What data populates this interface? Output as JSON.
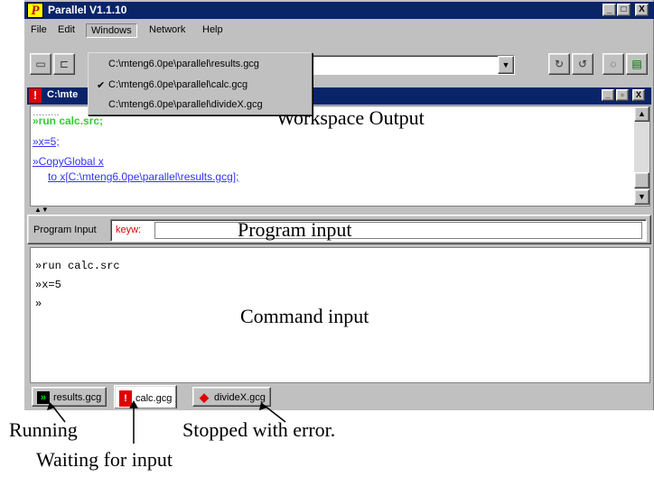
{
  "app": {
    "logo_letter": "P",
    "title": "Parallel V1.1.10",
    "minimize": "_",
    "maximize": "□",
    "close": "X"
  },
  "menubar": {
    "items": [
      "File",
      "Edit",
      "Windows",
      "Network",
      "Help"
    ]
  },
  "windows_menu": {
    "items": [
      "C:\\mteng6.0pe\\parallel\\results.gcg",
      "C:\\mteng6.0pe\\parallel\\calc.gcg",
      "C:\\mteng6.0pe\\parallel\\divideX.gcg"
    ],
    "checked_index": 1,
    "check_glyph": "✔"
  },
  "child": {
    "title": "C:\\mte",
    "icon_glyph": "!",
    "minimize": "_",
    "restore": "▫",
    "close": "X"
  },
  "workspace": {
    "lines": [
      {
        "text": "»run calc.src;",
        "color": "#33cc33"
      },
      {
        "text": "»x=5;",
        "color": "#3333ff"
      },
      {
        "text": "»CopyGlobal x",
        "color": "#3333ff"
      },
      {
        "text": "to x[C:\\mteng6.0pe\\parallel\\results.gcg];",
        "color": "#3333ff"
      }
    ],
    "overlay_label": "Workspace Output"
  },
  "program_input": {
    "label": "Program Input",
    "keyw": "keyw:",
    "overlay_label": "Program input"
  },
  "command_input": {
    "lines": [
      "»run calc.src",
      "»x=5",
      "»"
    ],
    "overlay_label": "Command input"
  },
  "tabs": [
    {
      "label": "results.gcg",
      "icon": "running-icon",
      "glyph": "»",
      "color": "#00aa00"
    },
    {
      "label": "calc.gcg",
      "icon": "waiting-icon",
      "glyph": "!",
      "color": "#e00000"
    },
    {
      "label": "divideX.gcg",
      "icon": "error-icon",
      "glyph": "◆",
      "color": "#e00000"
    }
  ],
  "annotations": {
    "running": "Running",
    "waiting": "Waiting for input",
    "stopped": "Stopped with error."
  },
  "colors": {
    "title_bar": "#0a246a",
    "window_face": "#c0c0c0",
    "keyw": "#e00000"
  }
}
